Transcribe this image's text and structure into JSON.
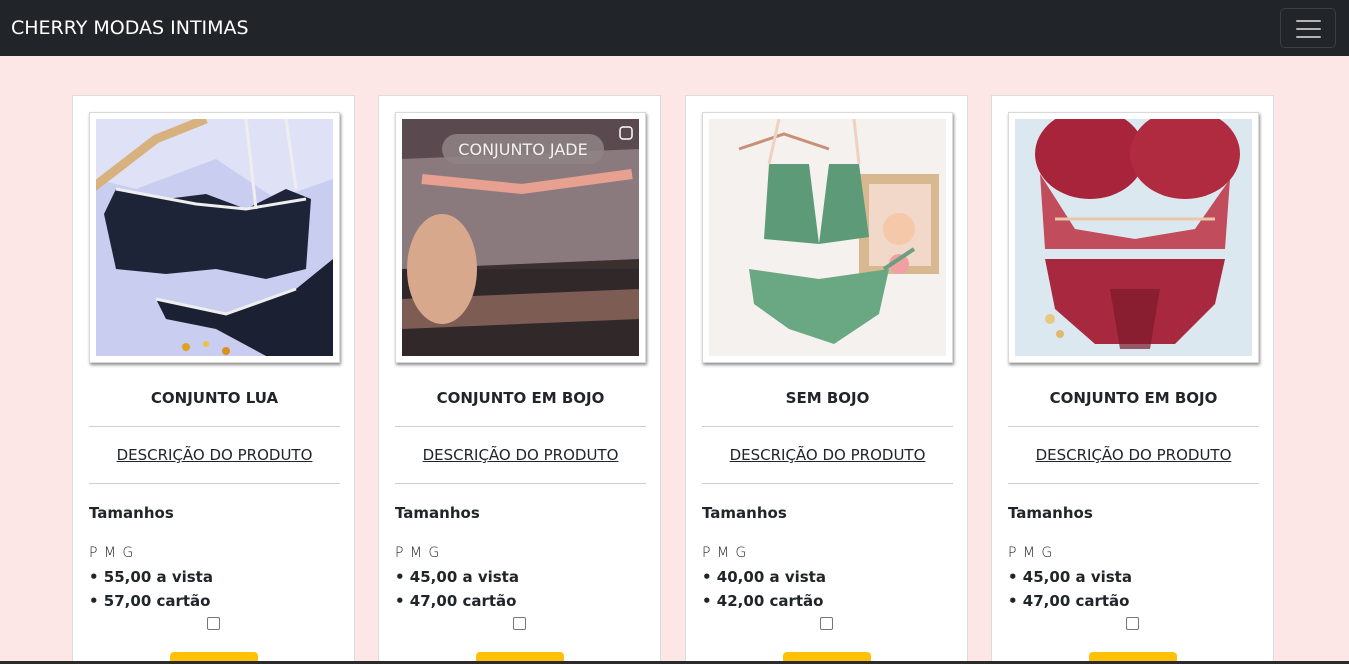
{
  "navbar": {
    "brand": "CHERRY MODAS INTIMAS",
    "toggler_icon": "hamburger-menu-icon",
    "background": "#212529"
  },
  "page": {
    "background": "#fde6e6",
    "accent_button": "#ffc107"
  },
  "products": [
    {
      "image_overlay_text": "",
      "title": "CONJUNTO LUA",
      "description_link": "DESCRIÇÃO DO PRODUTO",
      "sizes_heading": "Tamanhos",
      "sizes": "P M G",
      "price_cash": "• 55,00 a vista",
      "price_card": "• 57,00 cartão"
    },
    {
      "image_overlay_text": "CONJUNTO JADE",
      "title": "CONJUNTO EM BOJO",
      "description_link": "DESCRIÇÃO DO PRODUTO",
      "sizes_heading": "Tamanhos",
      "sizes": "P M G",
      "price_cash": "• 45,00 a vista",
      "price_card": "• 47,00 cartão"
    },
    {
      "image_overlay_text": "",
      "title": "SEM BOJO",
      "description_link": "DESCRIÇÃO DO PRODUTO",
      "sizes_heading": "Tamanhos",
      "sizes": "P M G",
      "price_cash": "• 40,00 a vista",
      "price_card": "• 42,00 cartão"
    },
    {
      "image_overlay_text": "",
      "title": "CONJUNTO EM BOJO",
      "description_link": "DESCRIÇÃO DO PRODUTO",
      "sizes_heading": "Tamanhos",
      "sizes": "P M G",
      "price_cash": "• 45,00 a vista",
      "price_card": "• 47,00 cartão"
    }
  ]
}
